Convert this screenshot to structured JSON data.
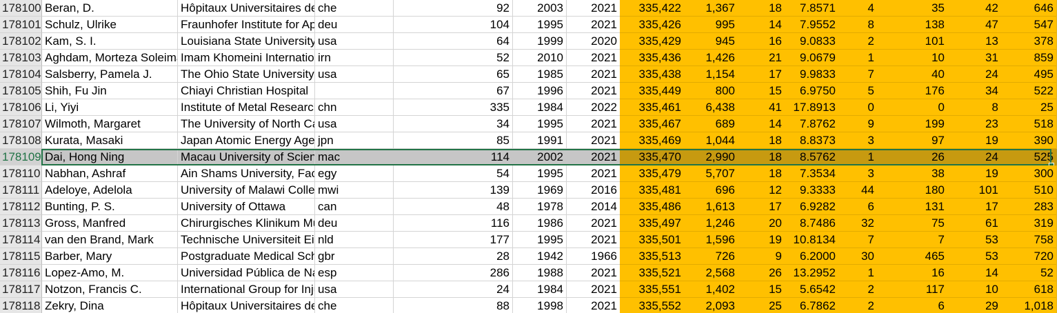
{
  "rows": [
    {
      "id": "178100",
      "name": "Beran, D.",
      "inst": "Hôpitaux Universitaires de Genève",
      "cc": "che",
      "c4": "92",
      "c5": "2003",
      "c6": "2021",
      "c7": "335,422",
      "c8": "1,367",
      "c9": "18",
      "c10": "7.8571",
      "c11": "4",
      "c12": "35",
      "c13": "42",
      "c14": "646"
    },
    {
      "id": "178101",
      "name": "Schulz, Ulrike",
      "inst": "Fraunhofer Institute for Applied",
      "cc": "deu",
      "c4": "104",
      "c5": "1995",
      "c6": "2021",
      "c7": "335,426",
      "c8": "995",
      "c9": "14",
      "c10": "7.9552",
      "c11": "8",
      "c12": "138",
      "c13": "47",
      "c14": "547"
    },
    {
      "id": "178102",
      "name": "Kam, S. I.",
      "inst": "Louisiana State University",
      "cc": "usa",
      "c4": "64",
      "c5": "1999",
      "c6": "2020",
      "c7": "335,429",
      "c8": "945",
      "c9": "16",
      "c10": "9.0833",
      "c11": "2",
      "c12": "101",
      "c13": "13",
      "c14": "378"
    },
    {
      "id": "178103",
      "name": "Aghdam, Morteza Soleimani",
      "inst": "Imam Khomeini International",
      "cc": "irn",
      "c4": "52",
      "c5": "2010",
      "c6": "2021",
      "c7": "335,436",
      "c8": "1,426",
      "c9": "21",
      "c10": "9.0679",
      "c11": "1",
      "c12": "10",
      "c13": "31",
      "c14": "859"
    },
    {
      "id": "178104",
      "name": "Salsberry, Pamela J.",
      "inst": "The Ohio State University",
      "cc": "usa",
      "c4": "65",
      "c5": "1985",
      "c6": "2021",
      "c7": "335,438",
      "c8": "1,154",
      "c9": "17",
      "c10": "9.9833",
      "c11": "7",
      "c12": "40",
      "c13": "24",
      "c14": "495"
    },
    {
      "id": "178105",
      "name": "Shih, Fu Jin",
      "inst": "Chiayi Christian Hospital",
      "cc": "",
      "c4": "67",
      "c5": "1996",
      "c6": "2021",
      "c7": "335,449",
      "c8": "800",
      "c9": "15",
      "c10": "6.9750",
      "c11": "5",
      "c12": "176",
      "c13": "34",
      "c14": "522"
    },
    {
      "id": "178106",
      "name": "Li, Yiyi",
      "inst": "Institute of Metal Research",
      "cc": "chn",
      "c4": "335",
      "c5": "1984",
      "c6": "2022",
      "c7": "335,461",
      "c8": "6,438",
      "c9": "41",
      "c10": "17.8913",
      "c11": "0",
      "c12": "0",
      "c13": "8",
      "c14": "25"
    },
    {
      "id": "178107",
      "name": "Wilmoth, Margaret",
      "inst": "The University of North Carolina",
      "cc": "usa",
      "c4": "34",
      "c5": "1995",
      "c6": "2021",
      "c7": "335,467",
      "c8": "689",
      "c9": "14",
      "c10": "7.8762",
      "c11": "9",
      "c12": "199",
      "c13": "23",
      "c14": "518"
    },
    {
      "id": "178108",
      "name": "Kurata, Masaki",
      "inst": "Japan Atomic Energy Agency",
      "cc": "jpn",
      "c4": "85",
      "c5": "1991",
      "c6": "2021",
      "c7": "335,469",
      "c8": "1,044",
      "c9": "18",
      "c10": "8.8373",
      "c11": "3",
      "c12": "97",
      "c13": "19",
      "c14": "390"
    },
    {
      "id": "178109",
      "name": "Dai, Hong Ning",
      "inst": "Macau University of Science",
      "cc": "mac",
      "c4": "114",
      "c5": "2002",
      "c6": "2021",
      "c7": "335,470",
      "c8": "2,990",
      "c9": "18",
      "c10": "8.5762",
      "c11": "1",
      "c12": "26",
      "c13": "24",
      "c14": "525"
    },
    {
      "id": "178110",
      "name": "Nabhan, Ashraf",
      "inst": "Ain Shams University, Faculty",
      "cc": "egy",
      "c4": "54",
      "c5": "1995",
      "c6": "2021",
      "c7": "335,479",
      "c8": "5,707",
      "c9": "18",
      "c10": "7.3534",
      "c11": "3",
      "c12": "38",
      "c13": "19",
      "c14": "300"
    },
    {
      "id": "178111",
      "name": "Adeloye, Adelola",
      "inst": "University of Malawi College",
      "cc": "mwi",
      "c4": "139",
      "c5": "1969",
      "c6": "2016",
      "c7": "335,481",
      "c8": "696",
      "c9": "12",
      "c10": "9.3333",
      "c11": "44",
      "c12": "180",
      "c13": "101",
      "c14": "510"
    },
    {
      "id": "178112",
      "name": "Bunting, P. S.",
      "inst": "University of Ottawa",
      "cc": "can",
      "c4": "48",
      "c5": "1978",
      "c6": "2014",
      "c7": "335,486",
      "c8": "1,613",
      "c9": "17",
      "c10": "6.9282",
      "c11": "6",
      "c12": "131",
      "c13": "17",
      "c14": "283"
    },
    {
      "id": "178113",
      "name": "Gross, Manfred",
      "inst": "Chirurgisches Klinikum München",
      "cc": "deu",
      "c4": "116",
      "c5": "1986",
      "c6": "2021",
      "c7": "335,497",
      "c8": "1,246",
      "c9": "20",
      "c10": "8.7486",
      "c11": "32",
      "c12": "75",
      "c13": "61",
      "c14": "319"
    },
    {
      "id": "178114",
      "name": "van den Brand, Mark",
      "inst": "Technische Universiteit Eindhoven",
      "cc": "nld",
      "c4": "177",
      "c5": "1995",
      "c6": "2021",
      "c7": "335,501",
      "c8": "1,596",
      "c9": "19",
      "c10": "10.8134",
      "c11": "7",
      "c12": "7",
      "c13": "53",
      "c14": "758"
    },
    {
      "id": "178115",
      "name": "Barber, Mary",
      "inst": "Postgraduate Medical School",
      "cc": "gbr",
      "c4": "28",
      "c5": "1942",
      "c6": "1966",
      "c7": "335,513",
      "c8": "726",
      "c9": "9",
      "c10": "6.2000",
      "c11": "30",
      "c12": "465",
      "c13": "53",
      "c14": "720"
    },
    {
      "id": "178116",
      "name": "Lopez-Amo, M.",
      "inst": "Universidad Pública de Navarra",
      "cc": "esp",
      "c4": "286",
      "c5": "1988",
      "c6": "2021",
      "c7": "335,521",
      "c8": "2,568",
      "c9": "26",
      "c10": "13.2952",
      "c11": "1",
      "c12": "16",
      "c13": "14",
      "c14": "52"
    },
    {
      "id": "178117",
      "name": "Notzon, Francis C.",
      "inst": "International Group for Injury",
      "cc": "usa",
      "c4": "24",
      "c5": "1984",
      "c6": "2021",
      "c7": "335,551",
      "c8": "1,402",
      "c9": "15",
      "c10": "5.6542",
      "c11": "2",
      "c12": "117",
      "c13": "10",
      "c14": "618"
    },
    {
      "id": "178118",
      "name": "Zekry, Dina",
      "inst": "Hôpitaux Universitaires de Genève",
      "cc": "che",
      "c4": "88",
      "c5": "1998",
      "c6": "2021",
      "c7": "335,552",
      "c8": "2,093",
      "c9": "25",
      "c10": "6.7862",
      "c11": "2",
      "c12": "6",
      "c13": "29",
      "c14": "1,018"
    }
  ],
  "selected_row_id": "178109",
  "colors": {
    "highlight_fill": "#ffc000",
    "selection_border": "#217346",
    "selected_fill": "#c6c6c6"
  }
}
